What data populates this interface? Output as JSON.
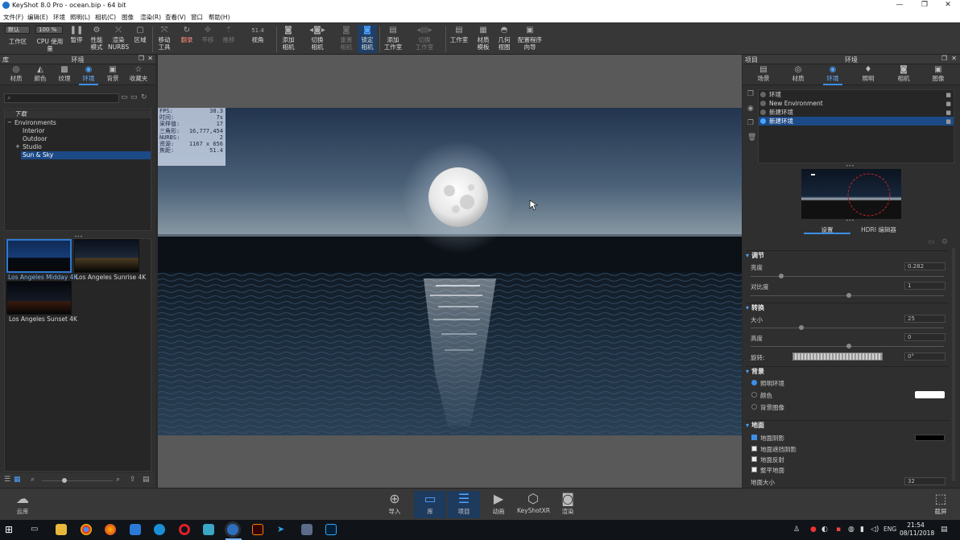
{
  "window": {
    "title": "KeyShot 8.0 Pro  -  ocean.bip  -  64 bit",
    "minimize": "—",
    "maximize": "❐",
    "close": "✕"
  },
  "menu": [
    "文件(F)",
    "编辑(E)",
    "环境",
    "照明(L)",
    "相机(C)",
    "图像",
    "渲染(R)",
    "查看(V)",
    "窗口",
    "帮助(H)"
  ],
  "toolbar": {
    "workspace_combo": "默认",
    "zoom_combo": "100 %",
    "workspace_label": "工作区",
    "cpu_label": "CPU 使用量",
    "pause_label": "暂停",
    "perf_label": "性能\n模式",
    "nurbs_label": "渲染\nNURBS",
    "region_label": "区域",
    "move_label": "移动\n工具",
    "reset_label": "翻录",
    "pan_label": "平移",
    "push_label": "推移",
    "fov_value": "51.4",
    "fov_label": "视角",
    "add_camera_label": "添加\n相机",
    "switch_camera_label": "切换\n相机",
    "reset_camera_label": "重置\n相机",
    "lock_camera_label": "锁定\n相机",
    "add_studio_label": "添加\n工作室",
    "switch_studio_label": "切换\n工作室",
    "studio_label": "工作室",
    "material_template_label": "材质\n模板",
    "geometry_view_label": "几何\n视图",
    "config_wizard_label": "配置程序\n向导"
  },
  "library": {
    "header_left": "库",
    "header_title": "环境",
    "tabs": [
      {
        "label": "材质",
        "icon": "sphere-icon"
      },
      {
        "label": "颜色",
        "icon": "palette-icon"
      },
      {
        "label": "纹理",
        "icon": "texture-icon"
      },
      {
        "label": "环境",
        "icon": "globe-icon"
      },
      {
        "label": "背景",
        "icon": "image-icon"
      },
      {
        "label": "收藏夹",
        "icon": "star-icon"
      }
    ],
    "search_placeholder": "",
    "tree": [
      {
        "label": "下载",
        "level": 0
      },
      {
        "label": "Environments",
        "level": 0
      },
      {
        "label": "Interior",
        "level": 1
      },
      {
        "label": "Outdoor",
        "level": 1
      },
      {
        "label": "Studio",
        "level": 1
      },
      {
        "label": "Sun & Sky",
        "level": 1
      }
    ],
    "thumbnails": [
      "Los Angeles Midday 4K",
      "Los Angeles Sunrise 4K",
      "Los Angeles Sunset 4K"
    ]
  },
  "stats": [
    {
      "k": "FPS:",
      "v": "38.3"
    },
    {
      "k": "时间:",
      "v": "7s"
    },
    {
      "k": "采样值:",
      "v": "17"
    },
    {
      "k": "三角形:",
      "v": "16,777,454"
    },
    {
      "k": "NURBS:",
      "v": "2"
    },
    {
      "k": "资源:",
      "v": "1167 x 656"
    },
    {
      "k": "焦距:",
      "v": "51.4"
    }
  ],
  "project": {
    "header_left": "项目",
    "header_title": "环境",
    "tabs": [
      {
        "label": "场景",
        "icon": "scene-icon"
      },
      {
        "label": "材质",
        "icon": "sphere-icon"
      },
      {
        "label": "环境",
        "icon": "globe-icon"
      },
      {
        "label": "照明",
        "icon": "bulb-icon"
      },
      {
        "label": "相机",
        "icon": "camera-icon"
      },
      {
        "label": "图像",
        "icon": "image-icon"
      }
    ],
    "env_list": [
      "环境",
      "New Environment",
      "新建环境",
      "新建环境"
    ],
    "subtabs": [
      "设置",
      "HDRI 编辑器"
    ],
    "adjust": {
      "title": "调节",
      "brightness_label": "亮度",
      "brightness": "0.282",
      "contrast_label": "对比度",
      "contrast": "1"
    },
    "transform": {
      "title": "转换",
      "size_label": "大小",
      "size": "25",
      "height_label": "高度",
      "height": "0",
      "rotation_label": "旋转:",
      "rotation": "0°"
    },
    "background": {
      "title": "背景",
      "options": [
        "照明环境",
        "颜色",
        "背景图像"
      ]
    },
    "ground": {
      "title": "地面",
      "options": [
        "地面阴影",
        "地面遮挡阴影",
        "地面反射",
        "整平地面"
      ],
      "size_label": "地面大小",
      "size": "32"
    }
  },
  "bottombar": {
    "cloud": "云库",
    "import": "导入",
    "library": "库",
    "project": "项目",
    "animation": "动画",
    "keyshotxr": "KeyShotXR",
    "render": "渲染",
    "screenshot": "截屏"
  },
  "taskbar": {
    "time": "21:54",
    "date": "08/11/2018",
    "lang": "ENG"
  }
}
